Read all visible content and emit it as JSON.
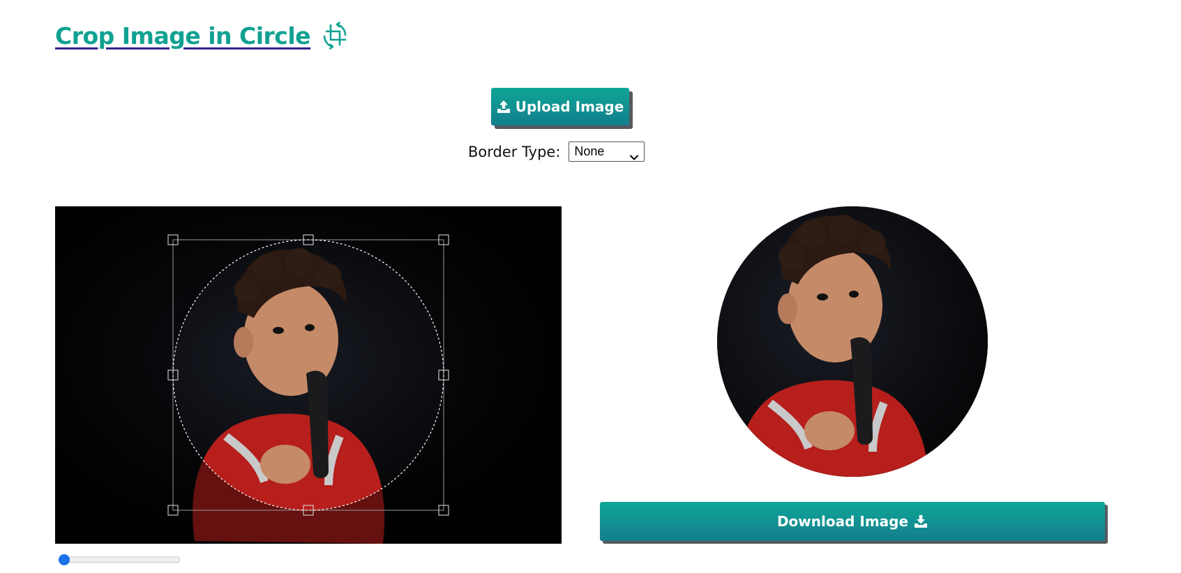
{
  "header": {
    "title": "Crop Image in Circle",
    "title_icon": "crop-icon",
    "title_color": "#10a192"
  },
  "upload": {
    "label": "Upload Image",
    "icon": "upload-icon"
  },
  "border": {
    "label": "Border Type:",
    "selected": "None"
  },
  "download": {
    "label": "Download Image",
    "icon": "download-icon"
  },
  "zoom": {
    "value": 0
  },
  "colors": {
    "accent": "#10a192",
    "button_gradient_top": "#0fa697",
    "button_gradient_bottom": "#137e8d",
    "button_shadow": "#555a5e",
    "title_underline": "#3a1f8c",
    "editor_background": "#020202"
  }
}
